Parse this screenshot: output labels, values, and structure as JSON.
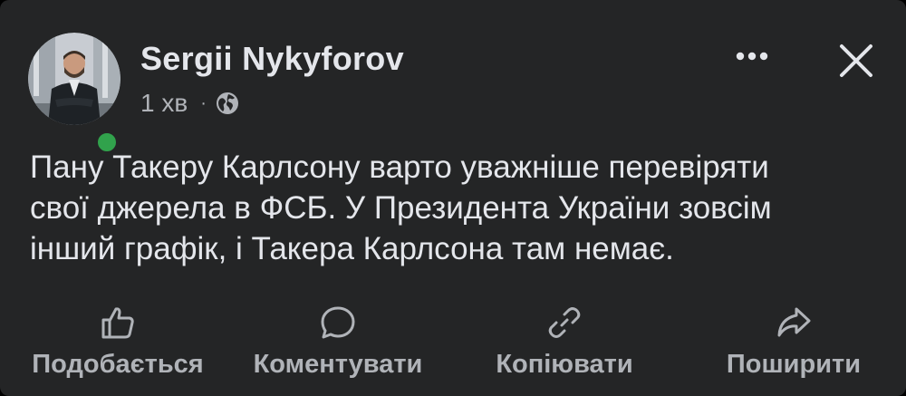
{
  "post": {
    "author": "Sergii Nykyforov",
    "time": "1 хв",
    "separator": "·",
    "privacy_icon": "globe-icon",
    "online": true,
    "text_lines": [
      "Пану Такеру Карлсону варто уважніше перевіряти",
      "свої джерела в ФСБ. У Президента України зовсім",
      "інший графік, і Такера Карлсона там немає."
    ]
  },
  "header_buttons": {
    "more_icon": "more-horizontal-icon",
    "close_icon": "close-icon"
  },
  "actions": [
    {
      "label": "Подобається",
      "icon": "thumbs-up-icon"
    },
    {
      "label": "Коментувати",
      "icon": "comment-icon"
    },
    {
      "label": "Копіювати",
      "icon": "link-icon"
    },
    {
      "label": "Поширити",
      "icon": "share-icon"
    }
  ],
  "colors": {
    "background": "#242526",
    "primary_text": "#e4e6eb",
    "secondary_text": "#b0b3b8",
    "online": "#31a24c"
  }
}
